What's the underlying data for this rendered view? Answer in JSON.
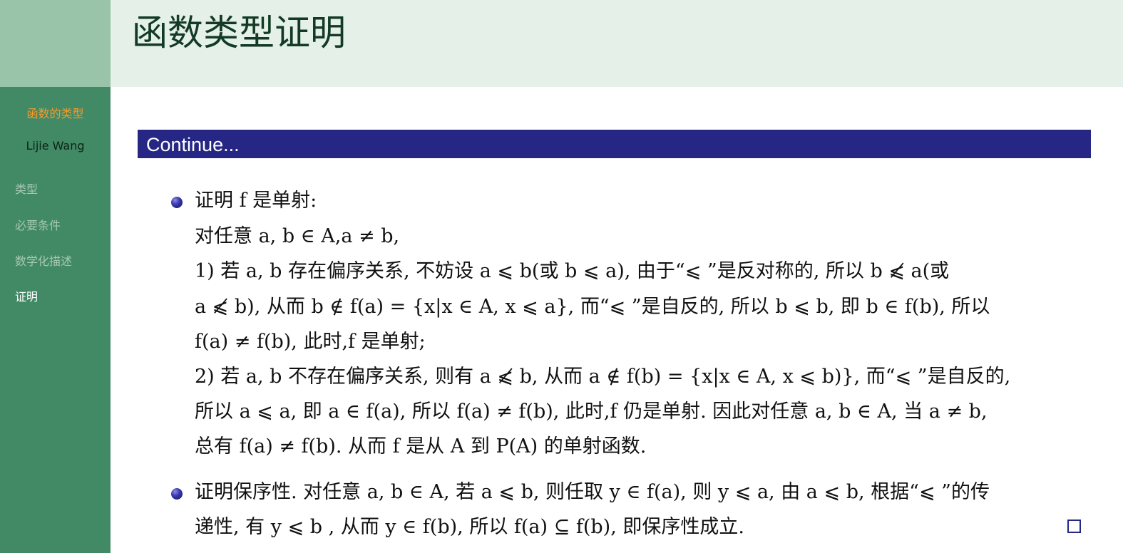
{
  "sidebar": {
    "title": "函数的类型",
    "author": "Lijie Wang",
    "nav": [
      {
        "label": "类型",
        "active": false
      },
      {
        "label": "必要条件",
        "active": false
      },
      {
        "label": "数学化描述",
        "active": false
      },
      {
        "label": "证明",
        "active": true
      }
    ]
  },
  "header": {
    "title": "函数类型证明"
  },
  "block": {
    "title": "Continue..."
  },
  "content": {
    "lines": [
      "证明 f 是单射:",
      "对任意 a, b ∈ A,a ≠ b,",
      "1) 若 a, b 存在偏序关系, 不妨设 a ⩽ b(或 b ⩽ a), 由于“⩽ ”是反对称的, 所以 b ⩽̸ a(或",
      "a ⩽̸ b), 从而 b ∉ f(a) = {x|x ∈ A, x ⩽ a}, 而“⩽ ”是自反的, 所以 b ⩽ b, 即 b ∈ f(b), 所以",
      "f(a) ≠ f(b), 此时,f 是单射;",
      "2) 若 a, b 不存在偏序关系, 则有 a ⩽̸ b, 从而 a ∉ f(b) = {x|x ∈ A, x ⩽ b)}, 而“⩽ ”是自反的,",
      "所以 a ⩽ a, 即 a ∈ f(a), 所以 f(a) ≠ f(b), 此时,f 仍是单射. 因此对任意 a, b ∈ A, 当 a ≠ b,",
      "总有 f(a) ≠ f(b). 从而 f 是从 A 到 P(A) 的单射函数.",
      "证明保序性. 对任意 a, b ∈ A, 若 a ⩽ b, 则任取 y ∈ f(a), 则 y ⩽ a, 由 a ⩽ b, 根据“⩽ ”的传",
      "递性, 有 y ⩽ b , 从而 y ∈ f(b), 所以 f(a) ⊆ f(b), 即保序性成立."
    ]
  }
}
